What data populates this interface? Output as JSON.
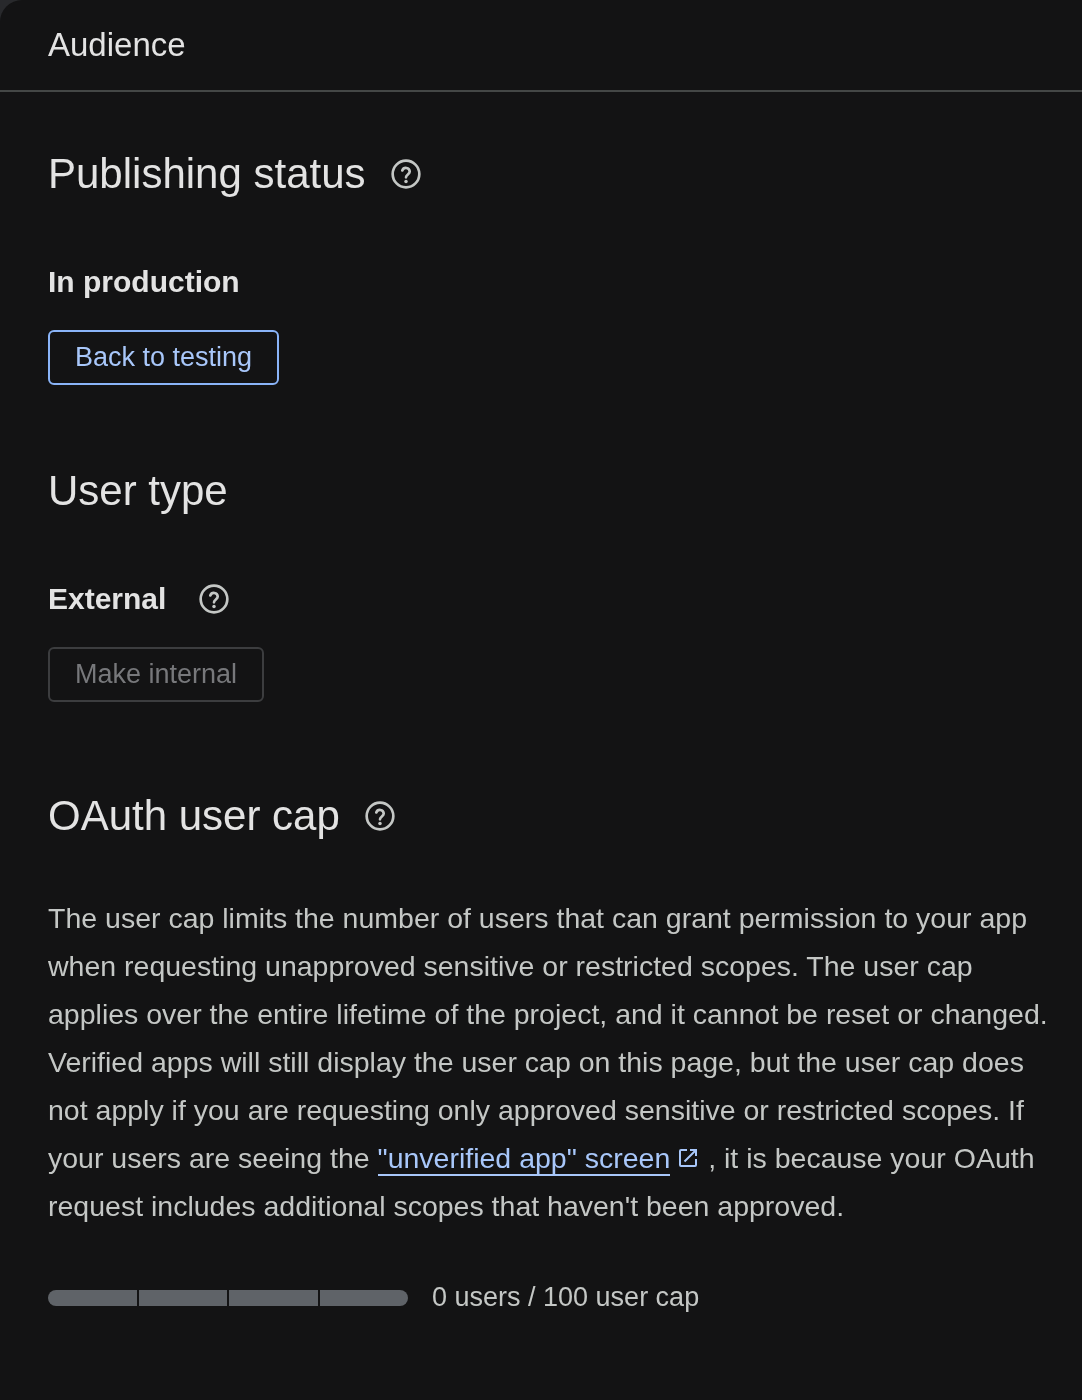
{
  "header": {
    "title": "Audience"
  },
  "publishing_status": {
    "heading": "Publishing status",
    "status": "In production",
    "button": {
      "label": "Back to testing",
      "disabled": false
    }
  },
  "user_type": {
    "heading": "User type",
    "value": "External",
    "button": {
      "label": "Make internal",
      "disabled": true
    }
  },
  "user_cap": {
    "heading": "OAuth user cap",
    "description": {
      "before": "The user cap limits the number of users that can grant permission to your app when requesting unapproved sensitive or restricted scopes. The user cap applies over the entire lifetime of the project, and it cannot be reset or changed. Verified apps will still display the user cap on this page, but the user cap does not apply if you are requesting only approved sensitive or restricted scopes. If your users are seeing the ",
      "link": "\"unverified app\" screen",
      "after": " , it is because your OAuth request includes additional scopes that haven't been approved."
    },
    "meter": {
      "reading": "0 users / 100 user cap"
    }
  }
}
